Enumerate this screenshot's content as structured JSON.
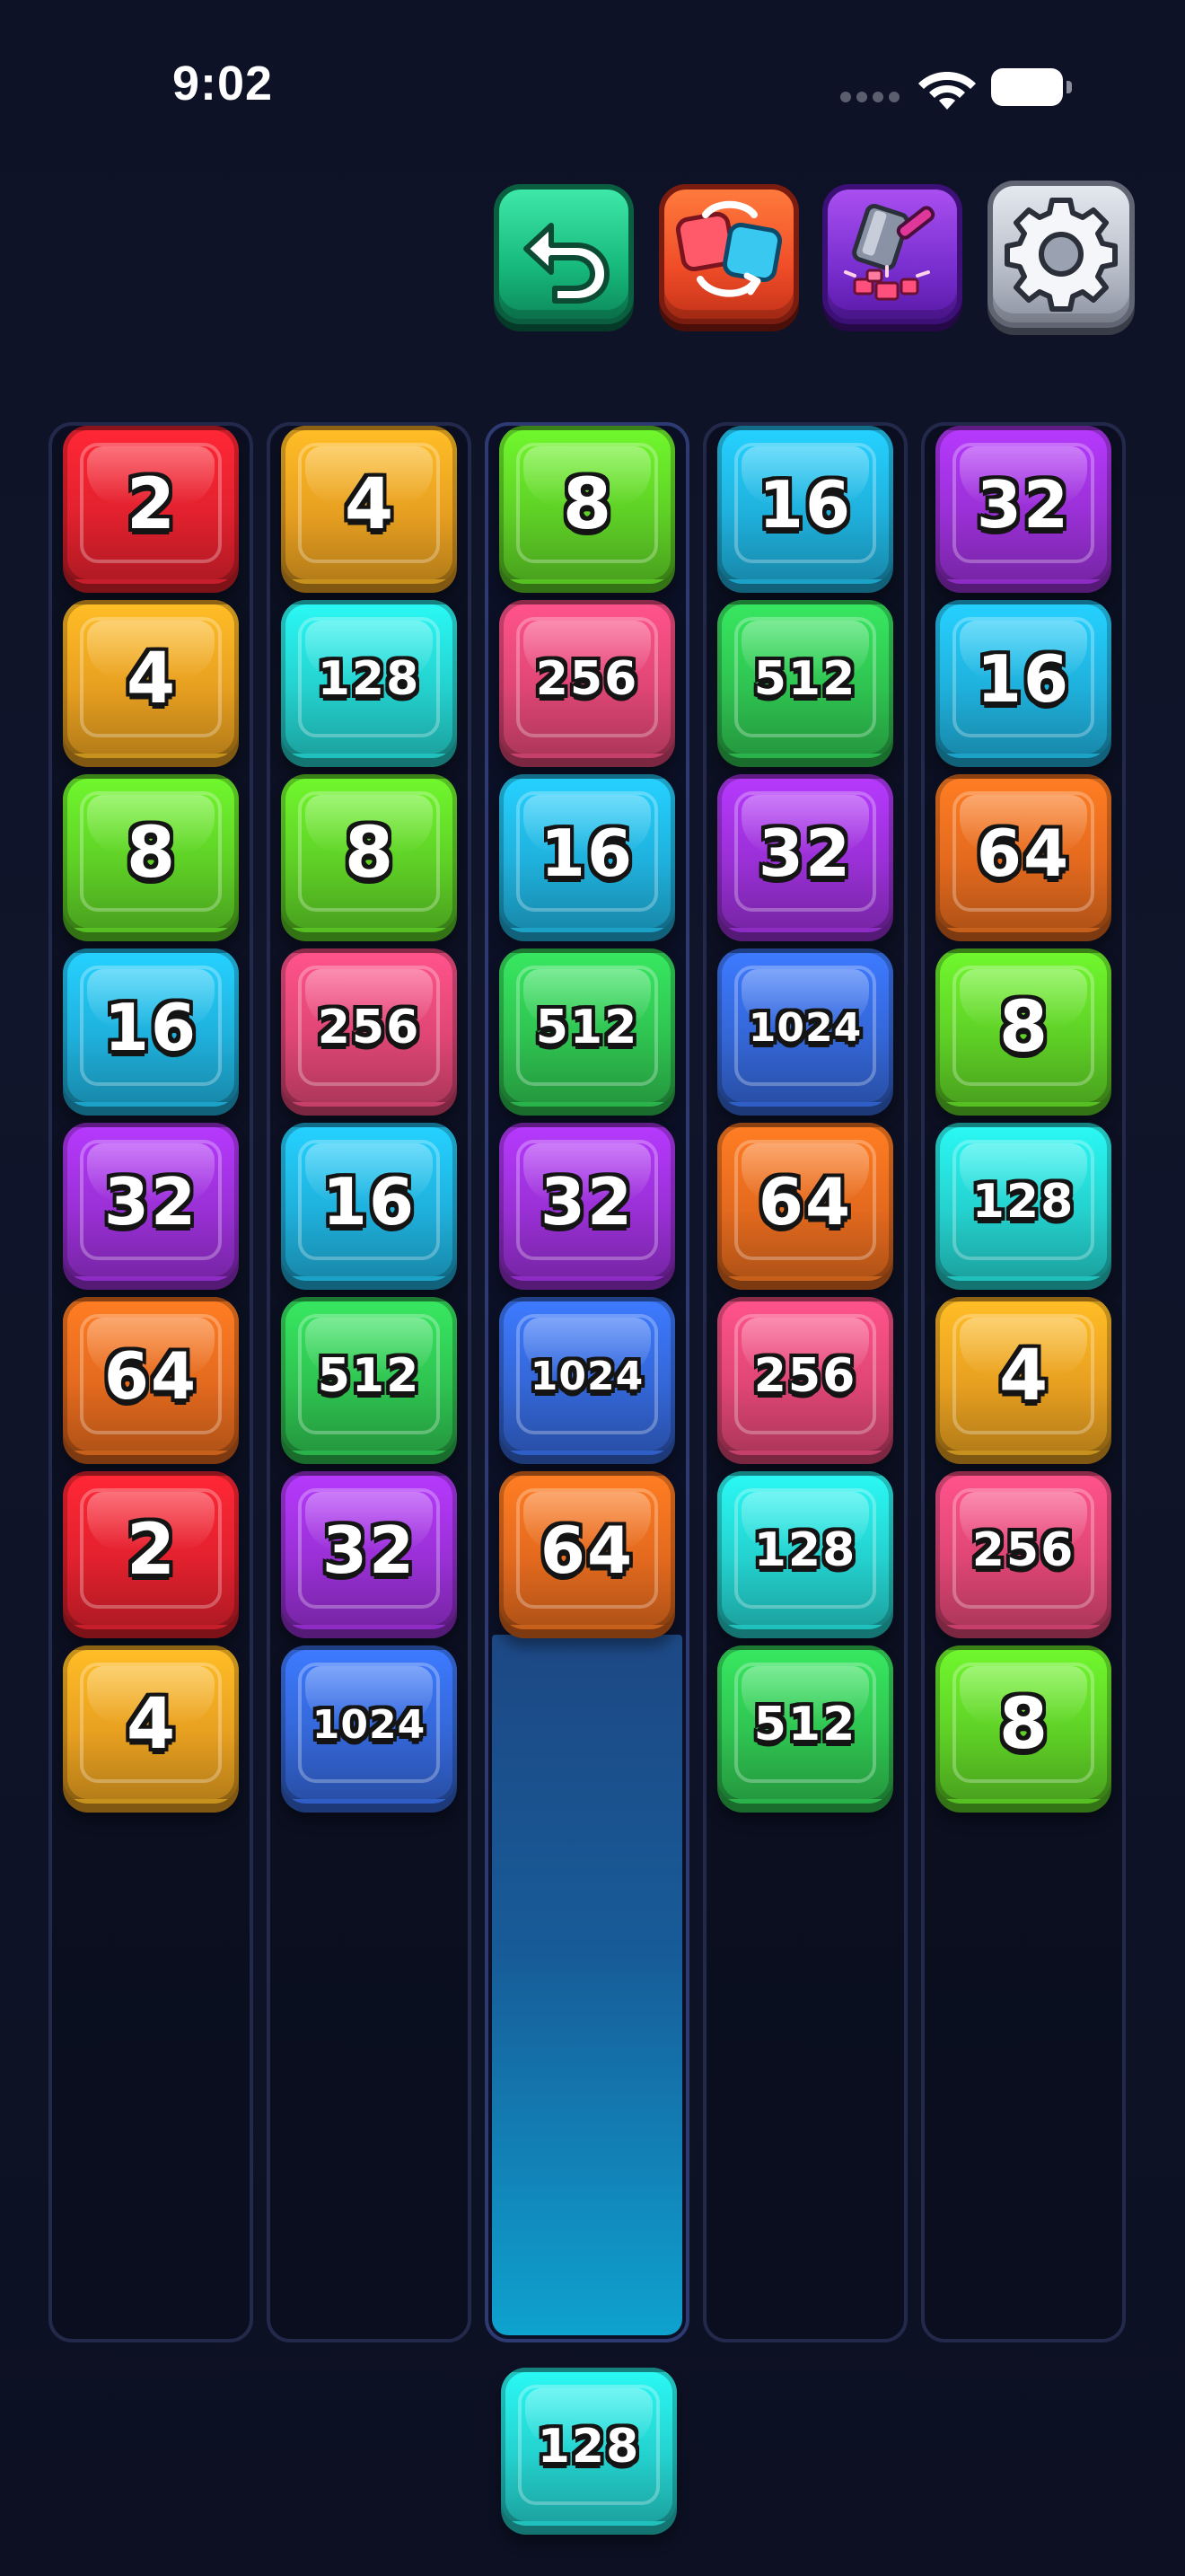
{
  "status_bar": {
    "time": "9:02",
    "signal_icon": "cellular-dots-icon",
    "wifi_icon": "wifi-icon",
    "battery_icon": "battery-icon"
  },
  "toolbar": {
    "buttons": [
      {
        "name": "undo-button",
        "icon": "undo-arrow-icon"
      },
      {
        "name": "swap-button",
        "icon": "swap-tiles-icon"
      },
      {
        "name": "hammer-button",
        "icon": "hammer-icon"
      },
      {
        "name": "settings-button",
        "icon": "gear-icon"
      }
    ]
  },
  "colors": {
    "2": "#e3212e",
    "4": "#e8a020",
    "8": "#5fd126",
    "16": "#1fb1dd",
    "32": "#9a30d6",
    "64": "#e46a1e",
    "128": "#24d2cf",
    "256": "#e04676",
    "512": "#2fc451",
    "1024": "#3467d8"
  },
  "board": {
    "columns": [
      {
        "tiles": [
          "2",
          "4",
          "8",
          "16",
          "32",
          "64",
          "2",
          "4"
        ]
      },
      {
        "tiles": [
          "4",
          "128",
          "8",
          "256",
          "16",
          "512",
          "32",
          "1024"
        ]
      },
      {
        "tiles": [
          "8",
          "256",
          "16",
          "512",
          "32",
          "1024",
          "64"
        ],
        "highlighted": true
      },
      {
        "tiles": [
          "16",
          "512",
          "32",
          "1024",
          "64",
          "256",
          "128",
          "512"
        ]
      },
      {
        "tiles": [
          "32",
          "16",
          "64",
          "8",
          "128",
          "4",
          "256",
          "8"
        ]
      }
    ]
  },
  "next_tile": {
    "value": "128"
  }
}
